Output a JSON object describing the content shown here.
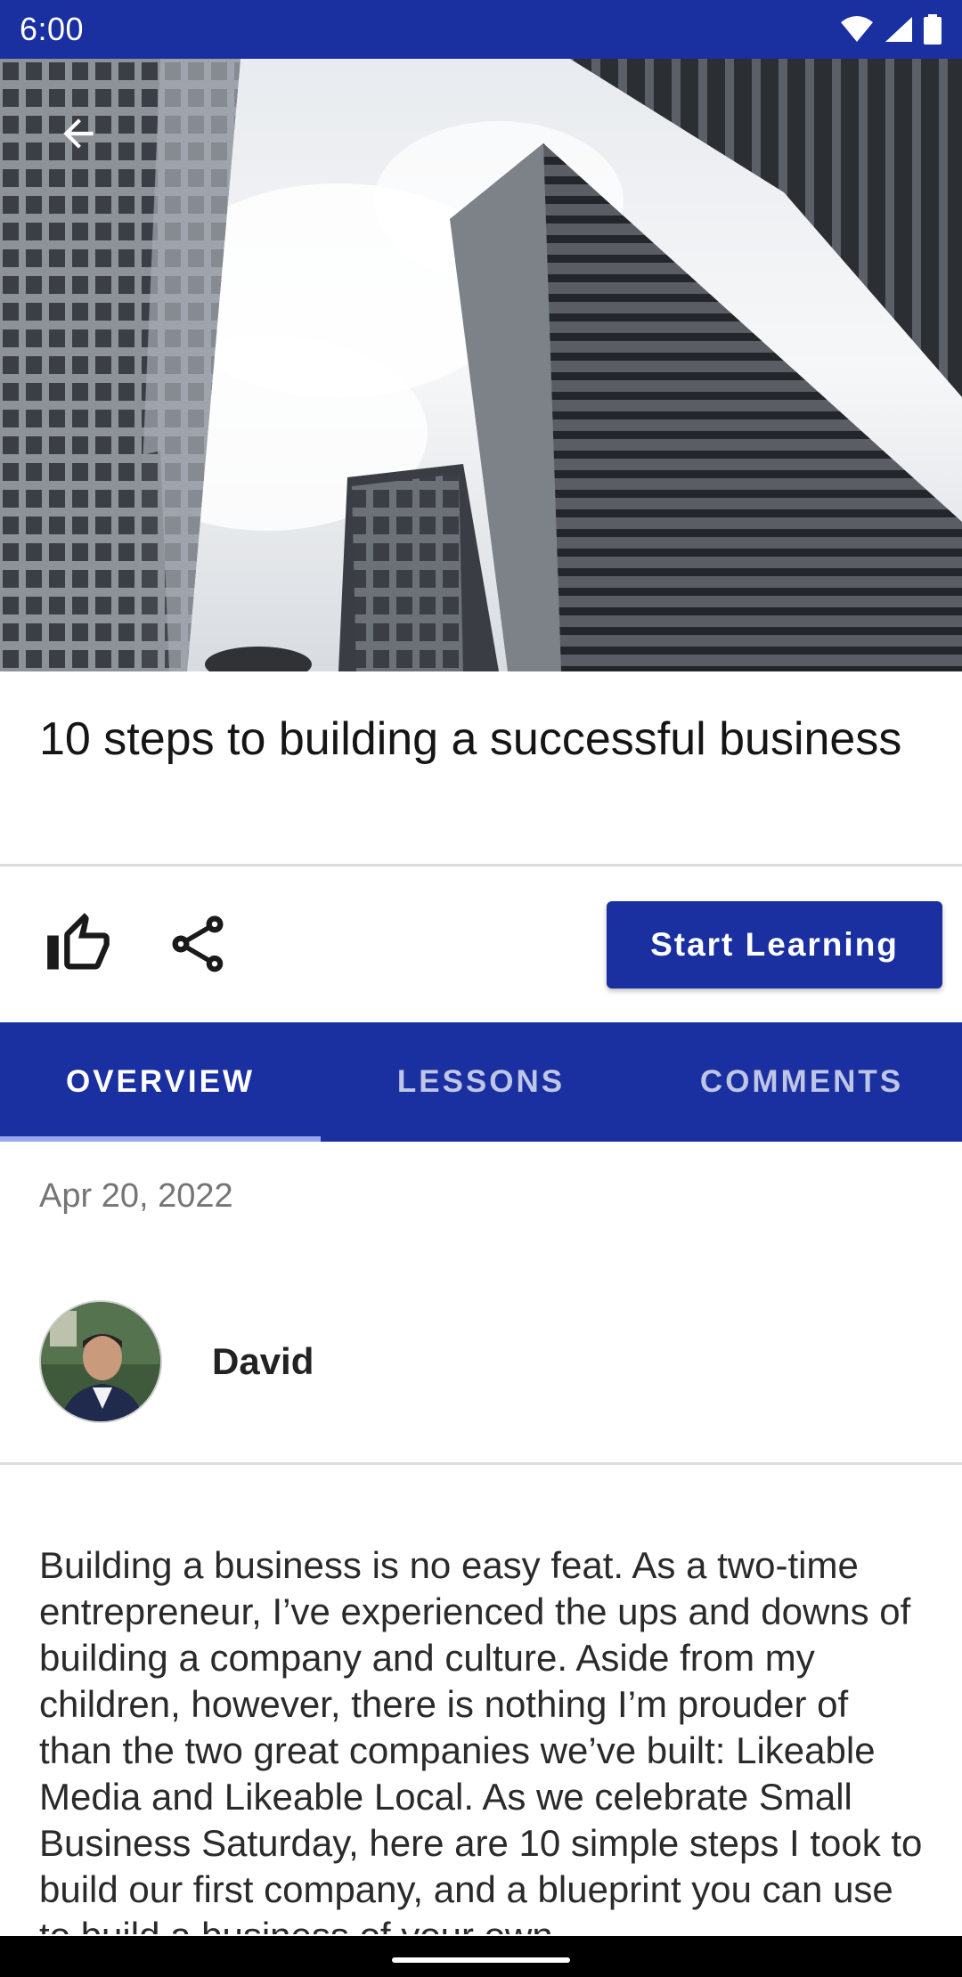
{
  "status_bar": {
    "time": "6:00"
  },
  "hero": {
    "image": "skyscrapers-photo"
  },
  "article": {
    "title": "10 steps to building a successful business",
    "date": "Apr 20, 2022",
    "author": "David",
    "body": "Building a business is no easy feat. As a two-time entrepreneur, I’ve experienced the ups and downs of building a company and culture. Aside from my children, however, there is nothing I’m prouder of than the two great companies we’ve built: Likeable Media and Likeable Local. As we celebrate Small Business Saturday, here are 10 simple steps I took to build our first company, and a blueprint you can use to build a business of your own."
  },
  "actions": {
    "start_label": "Start Learning"
  },
  "tabs": [
    {
      "label": "OVERVIEW",
      "active": true
    },
    {
      "label": "LESSONS",
      "active": false
    },
    {
      "label": "COMMENTS",
      "active": false
    }
  ],
  "colors": {
    "primary": "#1a2fa0",
    "indicator": "#9aa7ee"
  }
}
